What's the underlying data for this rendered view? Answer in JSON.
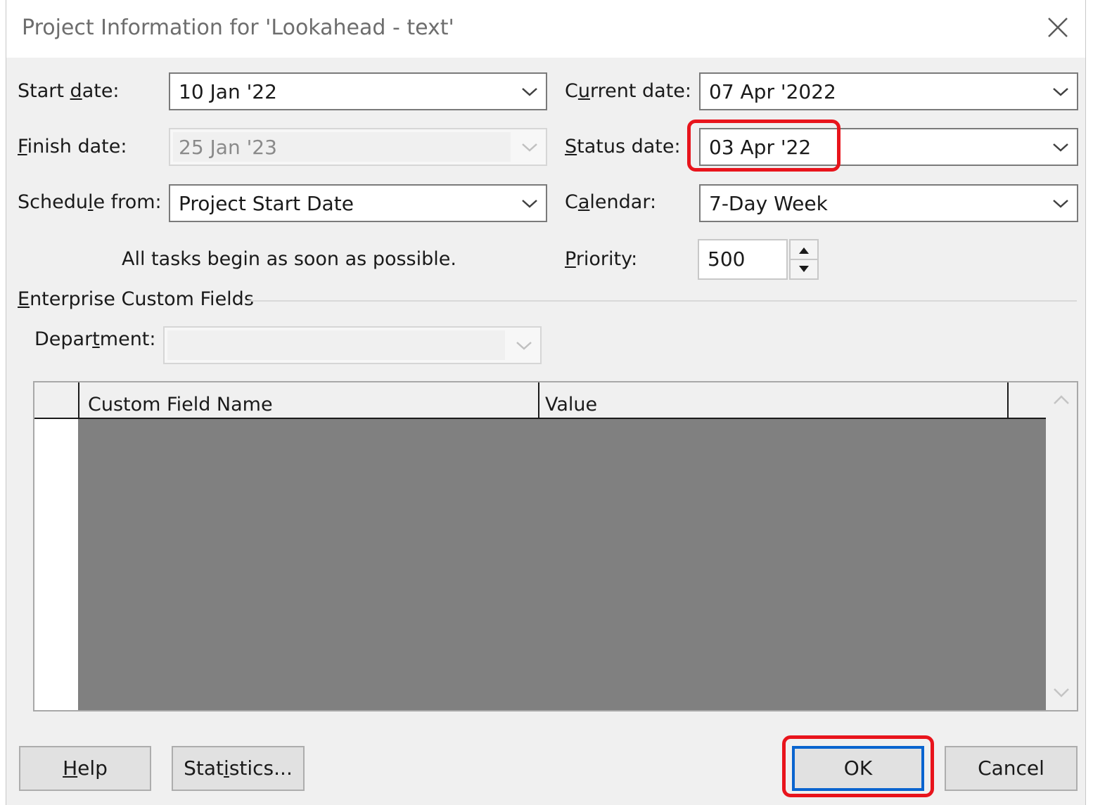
{
  "dialog": {
    "title": "Project Information for 'Lookahead - text'"
  },
  "fields": {
    "start_date": {
      "label_pre": "Start ",
      "label_key": "d",
      "label_post": "ate:",
      "value": "10 Jan '22"
    },
    "finish_date": {
      "label_pre": "",
      "label_key": "F",
      "label_post": "inish date:",
      "value": "25 Jan '23"
    },
    "schedule_from": {
      "label_pre": "Schedu",
      "label_key": "l",
      "label_post": "e from:",
      "value": "Project Start Date"
    },
    "current_date": {
      "label_pre": "C",
      "label_key": "u",
      "label_post": "rrent date:",
      "value": "07 Apr '2022"
    },
    "status_date": {
      "label_pre": "",
      "label_key": "S",
      "label_post": "tatus date:",
      "value": "03 Apr '22"
    },
    "calendar": {
      "label_pre": "C",
      "label_key": "a",
      "label_post": "lendar:",
      "value": "7-Day Week"
    },
    "priority": {
      "label_pre": "",
      "label_key": "P",
      "label_post": "riority:",
      "value": "500"
    },
    "schedule_note": "All tasks begin as soon as possible."
  },
  "enterprise": {
    "section_pre": "",
    "section_key": "E",
    "section_post": "nterprise Custom Fields",
    "department": {
      "label_pre": "Depar",
      "label_key": "t",
      "label_post": "ment:",
      "value": ""
    },
    "grid_columns": [
      "Custom Field Name",
      "Value"
    ]
  },
  "buttons": {
    "help": {
      "pre": "",
      "key": "H",
      "post": "elp"
    },
    "statistics": {
      "pre": "Stat",
      "key": "i",
      "post": "stics..."
    },
    "ok": "OK",
    "cancel": "Cancel"
  },
  "colors": {
    "highlight": "#e8141c",
    "default_button_border": "#0a64cf",
    "grid_fill": "#808080"
  }
}
